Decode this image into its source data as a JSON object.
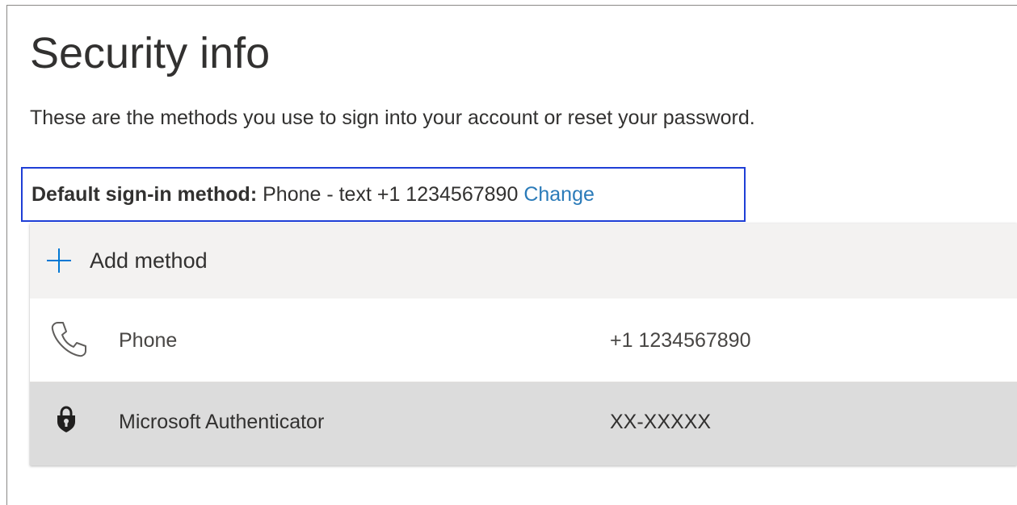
{
  "page": {
    "title": "Security info",
    "description": "These are the methods you use to sign into your account or reset your password."
  },
  "default_method": {
    "label": "Default sign-in method:",
    "value": "Phone - text +1 1234567890",
    "change_link": "Change",
    "link_color": "#2b7bb9",
    "highlight_color": "#1f3fd6"
  },
  "methods_panel": {
    "add_method": {
      "icon": "plus-icon",
      "label": "Add method",
      "accent_color": "#0078d4"
    },
    "methods": [
      {
        "icon": "phone-icon",
        "name": "Phone",
        "detail": "+1 1234567890"
      },
      {
        "icon": "authenticator-lock-icon",
        "name": "Microsoft Authenticator",
        "detail": "XX-XXXXX"
      }
    ]
  }
}
